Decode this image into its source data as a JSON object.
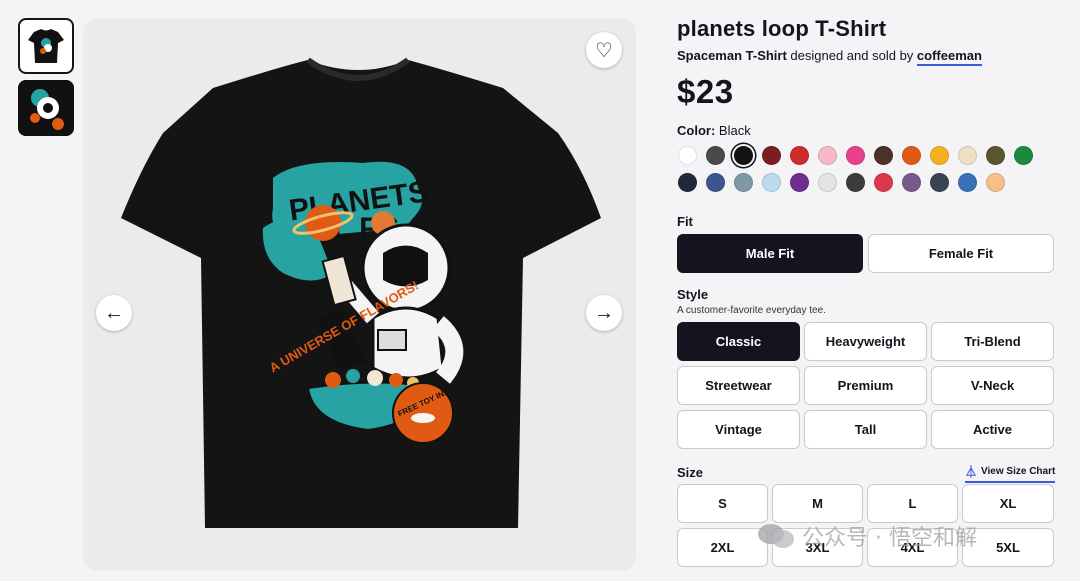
{
  "product": {
    "title": "planets loop T-Shirt",
    "subtitle_bold": "Spaceman T-Shirt",
    "subtitle_mid": " designed and sold by ",
    "designer": "coffeeman",
    "price": "$23"
  },
  "design_text": {
    "planets": "PLANETS",
    "loops": "L  PS",
    "universe": "A UNIVERSE OF FLAVORS!",
    "toy": "FREE TOY INSIDE"
  },
  "color": {
    "label": "Color:",
    "selected": "Black",
    "swatches": [
      "#ffffff",
      "#4a4a4a",
      "#141414",
      "#7a1e22",
      "#d12a2a",
      "#f7b8c6",
      "#e8408a",
      "#4a3326",
      "#e05a14",
      "#f5b01e",
      "#ece0c6",
      "#5a5530",
      "#198a3e",
      "#1f2a3c",
      "#3a5590",
      "#7f97a6",
      "#bcdbee",
      "#6e2e8c",
      "#e4e4e4",
      "#3c3c3c",
      "#d93a4a",
      "#7a5a8c",
      "#3a4450",
      "#3a70b8",
      "#f5c088"
    ]
  },
  "fit": {
    "label": "Fit",
    "options": [
      "Male Fit",
      "Female Fit"
    ],
    "selected": "Male Fit"
  },
  "style": {
    "label": "Style",
    "hint": "A customer-favorite everyday tee.",
    "options": [
      "Classic",
      "Heavyweight",
      "Tri-Blend",
      "Streetwear",
      "Premium",
      "V-Neck",
      "Vintage",
      "Tall",
      "Active"
    ],
    "selected": "Classic"
  },
  "size": {
    "label": "Size",
    "chart_link": "View Size Chart",
    "options": [
      "S",
      "M",
      "L",
      "XL",
      "2XL",
      "3XL",
      "4XL",
      "5XL"
    ]
  },
  "icons": {
    "favorite": "heart-icon",
    "prev": "arrow-left-icon",
    "next": "arrow-right-icon",
    "size_chart": "hanger-icon"
  },
  "watermark": "公众号 · 悟空和解"
}
